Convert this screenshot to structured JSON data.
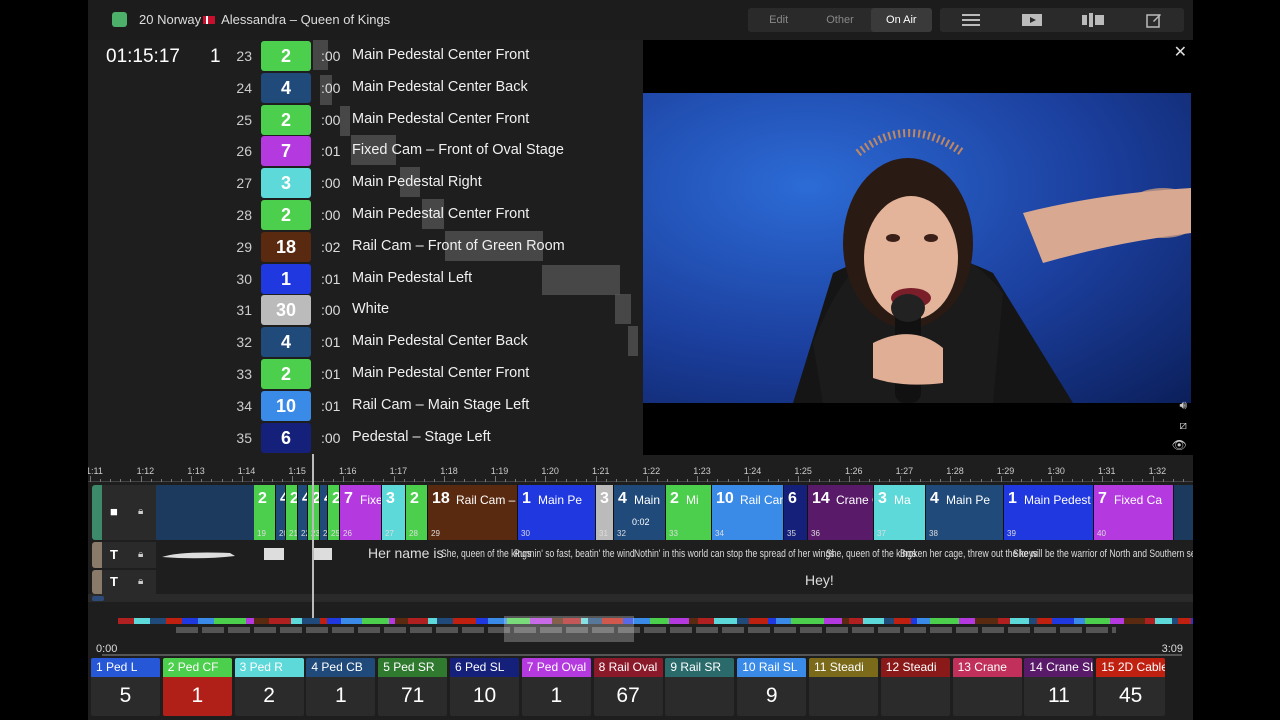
{
  "header": {
    "number": "20",
    "country": "Norway",
    "song": "Alessandra – Queen of Kings",
    "modes": [
      "Edit",
      "Other",
      "On Air"
    ],
    "active_mode": "On Air",
    "status_color": "#4caf6a"
  },
  "tools": [
    "list-icon",
    "video-preview-icon",
    "columns-icon",
    "edit-icon"
  ],
  "clock": {
    "timecode": "01:15:17",
    "count": "1"
  },
  "shots": [
    {
      "n": "23",
      "cam": "2",
      "color": "#4ccf4c",
      "dur": ":00",
      "desc": "Main Pedestal Center Front"
    },
    {
      "n": "24",
      "cam": "4",
      "color": "#1f4a7a",
      "dur": ":00",
      "desc": "Main Pedestal Center Back"
    },
    {
      "n": "25",
      "cam": "2",
      "color": "#4ccf4c",
      "dur": ":00",
      "desc": "Main Pedestal Center Front"
    },
    {
      "n": "26",
      "cam": "7",
      "color": "#b43ae0",
      "dur": ":01",
      "desc": "Fixed Cam – Front of Oval Stage"
    },
    {
      "n": "27",
      "cam": "3",
      "color": "#5ed9d9",
      "dur": ":00",
      "desc": "Main Pedestal Right"
    },
    {
      "n": "28",
      "cam": "2",
      "color": "#4ccf4c",
      "dur": ":00",
      "desc": "Main Pedestal Center Front"
    },
    {
      "n": "29",
      "cam": "18",
      "color": "#5a2a10",
      "dur": ":02",
      "desc": "Rail Cam – Front of Green Room"
    },
    {
      "n": "30",
      "cam": "1",
      "color": "#2038e0",
      "dur": ":01",
      "desc": "Main Pedestal Left"
    },
    {
      "n": "31",
      "cam": "30",
      "color": "#bbbbbb",
      "dur": ":00",
      "desc": "White"
    },
    {
      "n": "32",
      "cam": "4",
      "color": "#1f4a7a",
      "dur": ":01",
      "desc": "Main Pedestal Center Back"
    },
    {
      "n": "33",
      "cam": "2",
      "color": "#4ccf4c",
      "dur": ":01",
      "desc": "Main Pedestal Center Front"
    },
    {
      "n": "34",
      "cam": "10",
      "color": "#3a8ae8",
      "dur": ":01",
      "desc": "Rail Cam – Main Stage Left"
    },
    {
      "n": "35",
      "cam": "6",
      "color": "#14207a",
      "dur": ":00",
      "desc": "Pedestal – Stage Left"
    }
  ],
  "timeline": {
    "ticks": [
      "1:11",
      "1:12",
      "1:13",
      "1:14",
      "1:15",
      "1:16",
      "1:17",
      "1:18",
      "1:19",
      "1:20",
      "1:21",
      "1:22",
      "1:23",
      "1:24",
      "1:25",
      "1:26",
      "1:27",
      "1:28",
      "1:29",
      "1:30",
      "1:31",
      "1:32"
    ],
    "clips": [
      {
        "cam": "2",
        "label": "",
        "idx": "19",
        "color": "#4ccf4c"
      },
      {
        "cam": "4",
        "label": "",
        "idx": "20",
        "color": "#1f4a7a"
      },
      {
        "cam": "2",
        "label": "",
        "idx": "21",
        "color": "#4ccf4c"
      },
      {
        "cam": "4",
        "label": "",
        "idx": "22",
        "color": "#1f4a7a"
      },
      {
        "cam": "2",
        "label": "",
        "idx": "23",
        "color": "#4ccf4c"
      },
      {
        "cam": "4",
        "label": "",
        "idx": "24",
        "color": "#1f4a7a"
      },
      {
        "cam": "2",
        "label": "",
        "idx": "25",
        "color": "#4ccf4c"
      },
      {
        "cam": "7",
        "label": "Fixe",
        "idx": "26",
        "color": "#b43ae0"
      },
      {
        "cam": "3",
        "label": "",
        "idx": "27",
        "color": "#5ed9d9"
      },
      {
        "cam": "2",
        "label": "",
        "idx": "28",
        "color": "#4ccf4c"
      },
      {
        "cam": "18",
        "label": "Rail Cam – Fr",
        "idx": "29",
        "color": "#5a2a10"
      },
      {
        "cam": "1",
        "label": "Main Pe",
        "idx": "30",
        "color": "#2038e0"
      },
      {
        "cam": "3",
        "label": "",
        "idx": "31",
        "color": "#bbbbbb"
      },
      {
        "cam": "4",
        "label": "Main",
        "idx": "32",
        "color": "#1f4a7a",
        "extra": "0:02"
      },
      {
        "cam": "2",
        "label": "Mi",
        "idx": "33",
        "color": "#4ccf4c"
      },
      {
        "cam": "10",
        "label": "Rail Can",
        "idx": "34",
        "color": "#3a8ae8"
      },
      {
        "cam": "6",
        "label": "",
        "idx": "35",
        "color": "#14207a"
      },
      {
        "cam": "14",
        "label": "Crane C",
        "idx": "36",
        "color": "#5a1a6a"
      },
      {
        "cam": "3",
        "label": "Ma",
        "idx": "37",
        "color": "#5ed9d9"
      },
      {
        "cam": "4",
        "label": "Main Pe",
        "idx": "38",
        "color": "#1f4a7a"
      },
      {
        "cam": "1",
        "label": "Main Pedest",
        "idx": "39",
        "color": "#2038e0"
      },
      {
        "cam": "7",
        "label": "Fixed Ca",
        "idx": "40",
        "color": "#b43ae0"
      }
    ],
    "lyrics": [
      "Her name is",
      "She, queen of the kings",
      "Runnin' so fast, beatin' the wind",
      "Nothin' in this world can stop the spread of her wings",
      "She, queen of the kings",
      "Broken her cage, threw out the keys",
      "She will be the warrior of North and Southern seas"
    ],
    "lyric2": "Hey!",
    "start": "0:00",
    "end": "3:09"
  },
  "cameras": [
    {
      "label": "1 Ped L",
      "value": "5",
      "color": "#2557d6"
    },
    {
      "label": "2 Ped CF",
      "value": "1",
      "color": "#4ccf4c",
      "active": true
    },
    {
      "label": "3 Ped R",
      "value": "2",
      "color": "#5ed9d9"
    },
    {
      "label": "4 Ped CB",
      "value": "1",
      "color": "#1f4a7a"
    },
    {
      "label": "5 Ped SR",
      "value": "71",
      "color": "#2f7a2f"
    },
    {
      "label": "6 Ped SL",
      "value": "10",
      "color": "#14207a"
    },
    {
      "label": "7 Ped Oval",
      "value": "1",
      "color": "#b43ae0"
    },
    {
      "label": "8 Rail Oval",
      "value": "67",
      "color": "#8a1a2a"
    },
    {
      "label": "9 Rail SR",
      "value": "",
      "color": "#2a6a6a"
    },
    {
      "label": "10 Rail SL",
      "value": "9",
      "color": "#3a8ae8"
    },
    {
      "label": "11 Steadi",
      "value": "",
      "color": "#7a6a1a"
    },
    {
      "label": "12 Steadi",
      "value": "",
      "color": "#8a1a1a"
    },
    {
      "label": "13 Crane",
      "value": "",
      "color": "#c0305a"
    },
    {
      "label": "14 Crane SL",
      "value": "11",
      "color": "#5a1a6a"
    },
    {
      "label": "15 2D Cable",
      "value": "45",
      "color": "#c02010"
    }
  ]
}
